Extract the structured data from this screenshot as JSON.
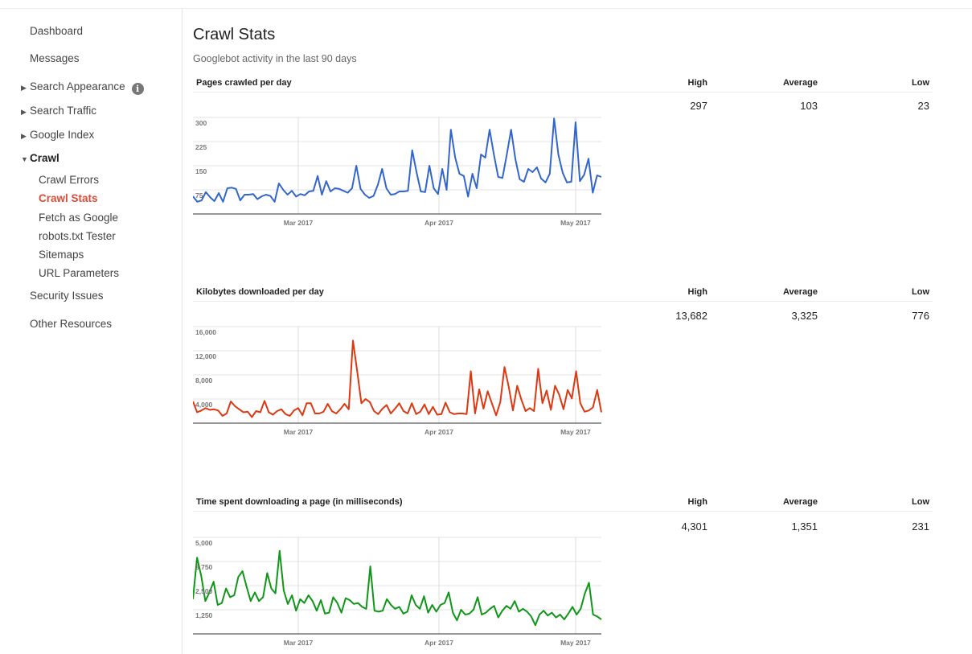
{
  "sidebar": {
    "dashboard": "Dashboard",
    "messages": "Messages",
    "search_appearance": "Search Appearance",
    "search_traffic": "Search Traffic",
    "google_index": "Google Index",
    "crawl": "Crawl",
    "crawl_items": [
      "Crawl Errors",
      "Crawl Stats",
      "Fetch as Google",
      "robots.txt Tester",
      "Sitemaps",
      "URL Parameters"
    ],
    "security_issues": "Security Issues",
    "other_resources": "Other Resources"
  },
  "page": {
    "title": "Crawl Stats",
    "subtitle": "Googlebot activity in the last 90 days"
  },
  "stat_labels": {
    "high": "High",
    "average": "Average",
    "low": "Low"
  },
  "sections": [
    {
      "title": "Pages crawled per day",
      "high": "297",
      "average": "103",
      "low": "23"
    },
    {
      "title": "Kilobytes downloaded per day",
      "high": "13,682",
      "average": "3,325",
      "low": "776"
    },
    {
      "title": "Time spent downloading a page (in milliseconds)",
      "high": "4,301",
      "average": "1,351",
      "low": "231"
    }
  ],
  "chart_data": [
    {
      "type": "line",
      "title": "Pages crawled per day",
      "color": "#3366cc",
      "x_tick_labels": [
        "Mar 2017",
        "Apr 2017",
        "May 2017"
      ],
      "y_tick_labels": [
        "75",
        "150",
        "225",
        "300"
      ],
      "ylim": [
        0,
        300
      ],
      "grid": true,
      "values": [
        55,
        38,
        42,
        68,
        52,
        40,
        65,
        38,
        80,
        82,
        78,
        42,
        60,
        60,
        62,
        46,
        55,
        60,
        56,
        38,
        95,
        75,
        60,
        72,
        54,
        62,
        58,
        70,
        72,
        118,
        60,
        102,
        70,
        80,
        78,
        72,
        66,
        80,
        150,
        78,
        60,
        50,
        56,
        90,
        140,
        80,
        60,
        62,
        70,
        70,
        72,
        198,
        130,
        70,
        68,
        150,
        80,
        62,
        140,
        75,
        262,
        175,
        125,
        118,
        54,
        125,
        80,
        185,
        175,
        262,
        185,
        115,
        112,
        185,
        262,
        170,
        108,
        100,
        140,
        130,
        145,
        110,
        98,
        125,
        297,
        185,
        128,
        98,
        100,
        285,
        102,
        122,
        172,
        66,
        120,
        115
      ]
    },
    {
      "type": "line",
      "title": "Kilobytes downloaded per day",
      "color": "#dc3912",
      "x_tick_labels": [
        "Mar 2017",
        "Apr 2017",
        "May 2017"
      ],
      "y_tick_labels": [
        "4,000",
        "8,000",
        "12,000",
        "16,000"
      ],
      "ylim": [
        0,
        16000
      ],
      "grid": true,
      "values": [
        3600,
        1800,
        2100,
        2500,
        2200,
        2300,
        2100,
        1200,
        1600,
        3600,
        2800,
        2300,
        1800,
        1900,
        1000,
        2000,
        1800,
        3700,
        1800,
        1400,
        2000,
        2300,
        1500,
        1200,
        2100,
        2500,
        1300,
        3300,
        3300,
        1600,
        1600,
        1900,
        3200,
        2000,
        1600,
        2300,
        3200,
        2300,
        13682,
        8700,
        3300,
        4000,
        3500,
        2000,
        1500,
        2400,
        3000,
        1600,
        2400,
        3300,
        2000,
        1600,
        3300,
        1500,
        1900,
        3100,
        1500,
        2700,
        1400,
        1500,
        3400,
        1800,
        1500,
        1600,
        1600,
        1500,
        8600,
        1600,
        5600,
        2400,
        5300,
        3300,
        1300,
        3500,
        9300,
        6000,
        2100,
        6200,
        3900,
        2000,
        2500,
        2000,
        9000,
        3300,
        5400,
        2200,
        6200,
        4700,
        2300,
        5500,
        4100,
        8600,
        3300,
        1900,
        2100,
        2600,
        5500,
        1800
      ]
    },
    {
      "type": "line",
      "title": "Time spent downloading a page (in milliseconds)",
      "color": "#109618",
      "x_tick_labels": [
        "Mar 2017",
        "Apr 2017",
        "May 2017"
      ],
      "y_tick_labels": [
        "1,250",
        "2,500",
        "3,750",
        "5,000"
      ],
      "ylim": [
        0,
        5000
      ],
      "grid": true,
      "values": [
        1800,
        3950,
        3000,
        1700,
        2150,
        2700,
        1500,
        1600,
        2350,
        1900,
        2000,
        2950,
        3250,
        2450,
        1700,
        2150,
        1700,
        1900,
        3150,
        2350,
        2100,
        4301,
        2250,
        1550,
        2000,
        1200,
        1800,
        1600,
        2000,
        1700,
        1200,
        1750,
        1050,
        1100,
        1900,
        1600,
        1100,
        1850,
        1750,
        1550,
        1600,
        1400,
        1300,
        3500,
        1200,
        1150,
        1200,
        1800,
        1500,
        1300,
        1400,
        1050,
        1150,
        2000,
        1500,
        1300,
        1950,
        1100,
        1500,
        1150,
        1500,
        1600,
        2150,
        1100,
        700,
        1250,
        1000,
        1050,
        1250,
        1900,
        1000,
        1100,
        1300,
        1450,
        850,
        1200,
        1450,
        1300,
        1700,
        1150,
        1300,
        1150,
        900,
        450,
        1000,
        1200,
        950,
        1100,
        850,
        1000,
        750,
        1050,
        1400,
        1000,
        1300,
        2100,
        2650,
        1000,
        900,
        750
      ]
    }
  ]
}
